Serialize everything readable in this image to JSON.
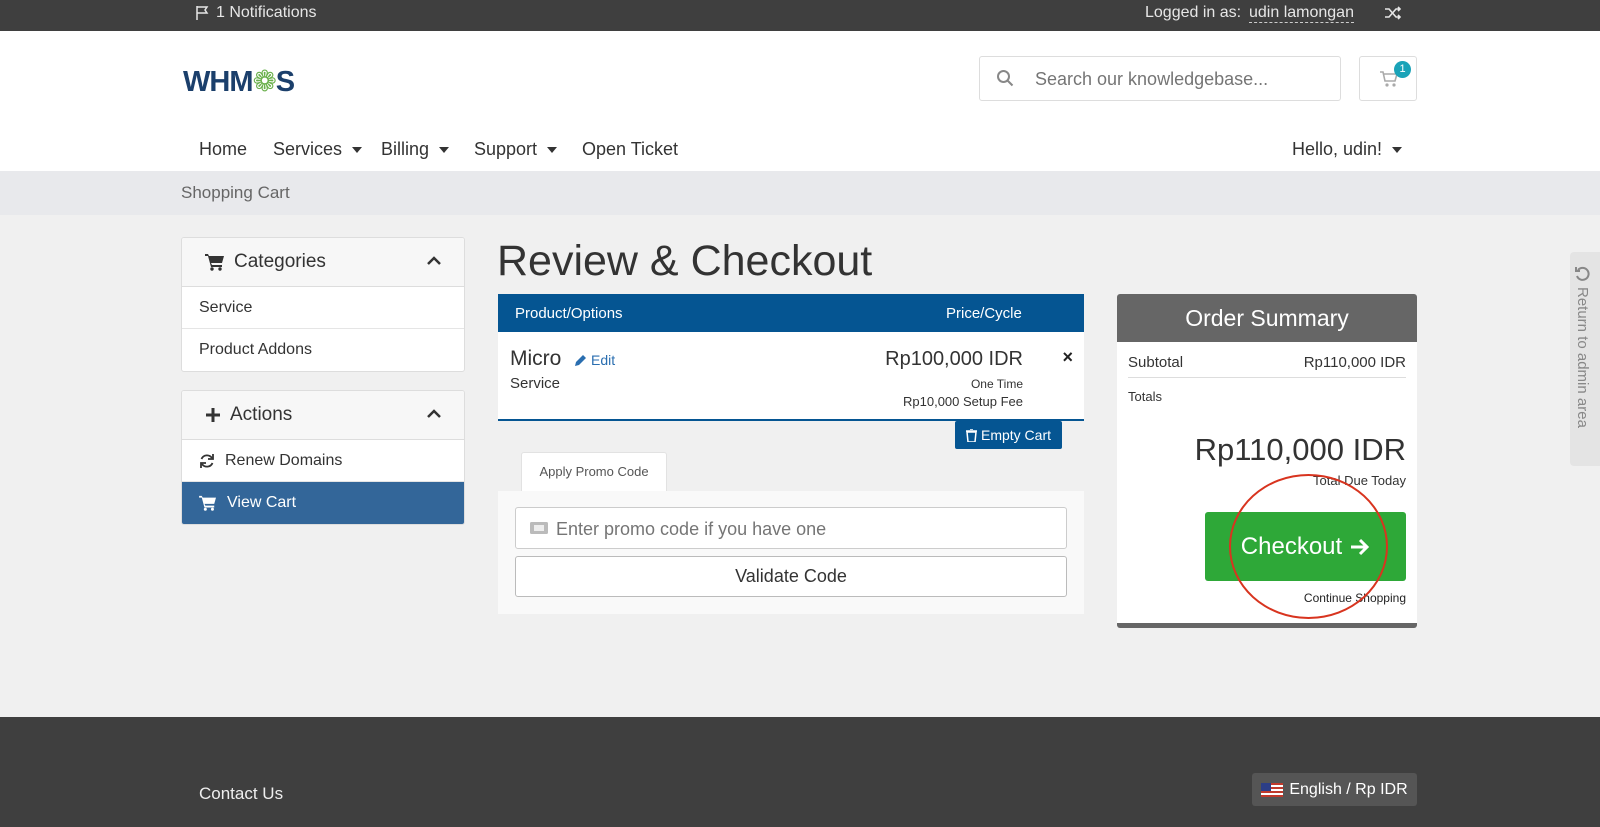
{
  "topbar": {
    "notifications": "1 Notifications",
    "logged_in_label": "Logged in as:",
    "username": "udin lamongan"
  },
  "header": {
    "logo_text_1": "WHM",
    "logo_gear": "❁",
    "logo_text_2": "S",
    "search_placeholder": "Search our knowledgebase...",
    "cart_count": "1"
  },
  "nav": {
    "home": "Home",
    "services": "Services",
    "billing": "Billing",
    "support": "Support",
    "open_ticket": "Open Ticket",
    "hello": "Hello, udin!"
  },
  "breadcrumb": "Shopping Cart",
  "sidebar": {
    "categories_title": "Categories",
    "categories": [
      "Service",
      "Product Addons"
    ],
    "actions_title": "Actions",
    "actions": [
      "Renew Domains",
      "View Cart"
    ]
  },
  "main": {
    "title": "Review & Checkout",
    "col_product": "Product/Options",
    "col_price": "Price/Cycle",
    "item": {
      "name": "Micro",
      "edit": "Edit",
      "type": "Service",
      "price": "Rp100,000 IDR",
      "cycle": "One Time",
      "setup": "Rp10,000 Setup Fee",
      "remove": "×"
    },
    "empty_cart": "Empty Cart",
    "promo_tab": "Apply Promo Code",
    "promo_placeholder": "Enter promo code if you have one",
    "validate": "Validate Code"
  },
  "summary": {
    "title": "Order Summary",
    "subtotal_label": "Subtotal",
    "subtotal_value": "Rp110,000 IDR",
    "totals_label": "Totals",
    "total": "Rp110,000 IDR",
    "due": "Total Due Today",
    "checkout": "Checkout",
    "continue": "Continue Shopping"
  },
  "admin_tab": "Return to admin area",
  "footer": {
    "contact": "Contact Us",
    "language": "English / Rp IDR"
  },
  "colors": {
    "primary": "#055592",
    "active": "#336699",
    "success": "#2ea838",
    "annotation": "#d8341f"
  }
}
